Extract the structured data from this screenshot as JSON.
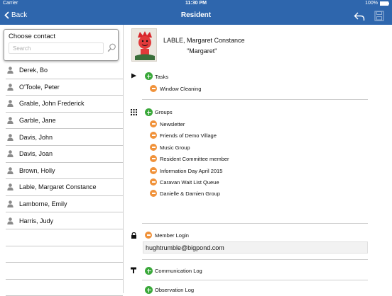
{
  "status": {
    "carrier": "Carrier",
    "time": "11:30 PM",
    "battery": "100%"
  },
  "nav": {
    "back_label": "Back",
    "title": "Resident"
  },
  "contacts_panel": {
    "heading": "Choose contact",
    "search_placeholder": "Search",
    "items": [
      "Derek, Bo",
      "O'Toole, Peter",
      "Grable, John Frederick",
      "Garble, Jane",
      "Davis, John",
      "Davis, Joan",
      "Brown, Holly",
      "Lable, Margaret Constance",
      "Lamborne, Emily",
      "Harris, Judy"
    ]
  },
  "resident": {
    "name": "LABLE, Margaret Constance",
    "nickname": "\"Margaret\""
  },
  "tasks": {
    "label": "Tasks",
    "items": [
      "Window Cleaning"
    ]
  },
  "groups": {
    "label": "Groups",
    "items": [
      "Newsletter",
      "Friends of Demo Village",
      "Music Group",
      "Resident Committee member",
      "Information Day April 2015",
      "Caravan Wait List Queue",
      "Danielle & Damien Group"
    ]
  },
  "member_login": {
    "label": "Member Login",
    "value": "hughtrumble@bigpond.com"
  },
  "communication_log": {
    "label": "Communication Log"
  },
  "observation_log": {
    "label": "Observation Log"
  },
  "colors": {
    "nav_bar": "#2e66ad",
    "add": "#3aa83a",
    "remove": "#f0923a"
  },
  "icons": {
    "back": "chevron-left-icon",
    "reply": "reply-icon",
    "save": "save-icon",
    "search": "search-icon",
    "person": "person-icon",
    "tasks": "flag-icon",
    "groups": "grid-icon",
    "login": "lock-icon",
    "comm": "hammer-icon"
  }
}
